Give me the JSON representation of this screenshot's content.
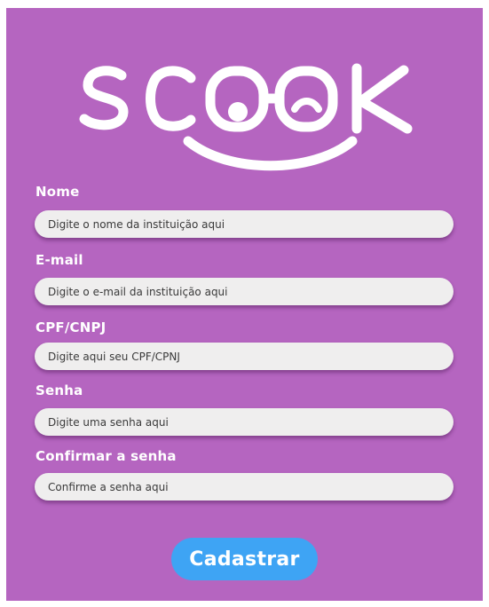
{
  "brand": {
    "logo_text": "SCOOK",
    "background_color": "#b565c0",
    "accent_color": "#3ea4f4"
  },
  "form": {
    "fields": [
      {
        "label": "Nome",
        "placeholder": "Digite o nome da instituição aqui",
        "value": ""
      },
      {
        "label": "E-mail",
        "placeholder": "Digite o e-mail da instituição aqui",
        "value": ""
      },
      {
        "label": "CPF/CNPJ",
        "placeholder": "Digite aqui seu CPF/CPNJ",
        "value": ""
      },
      {
        "label": "Senha",
        "placeholder": "Digite uma senha aqui",
        "value": ""
      },
      {
        "label": "Confirmar a senha",
        "placeholder": "Confirme a senha aqui",
        "value": ""
      }
    ],
    "submit_label": "Cadastrar"
  }
}
